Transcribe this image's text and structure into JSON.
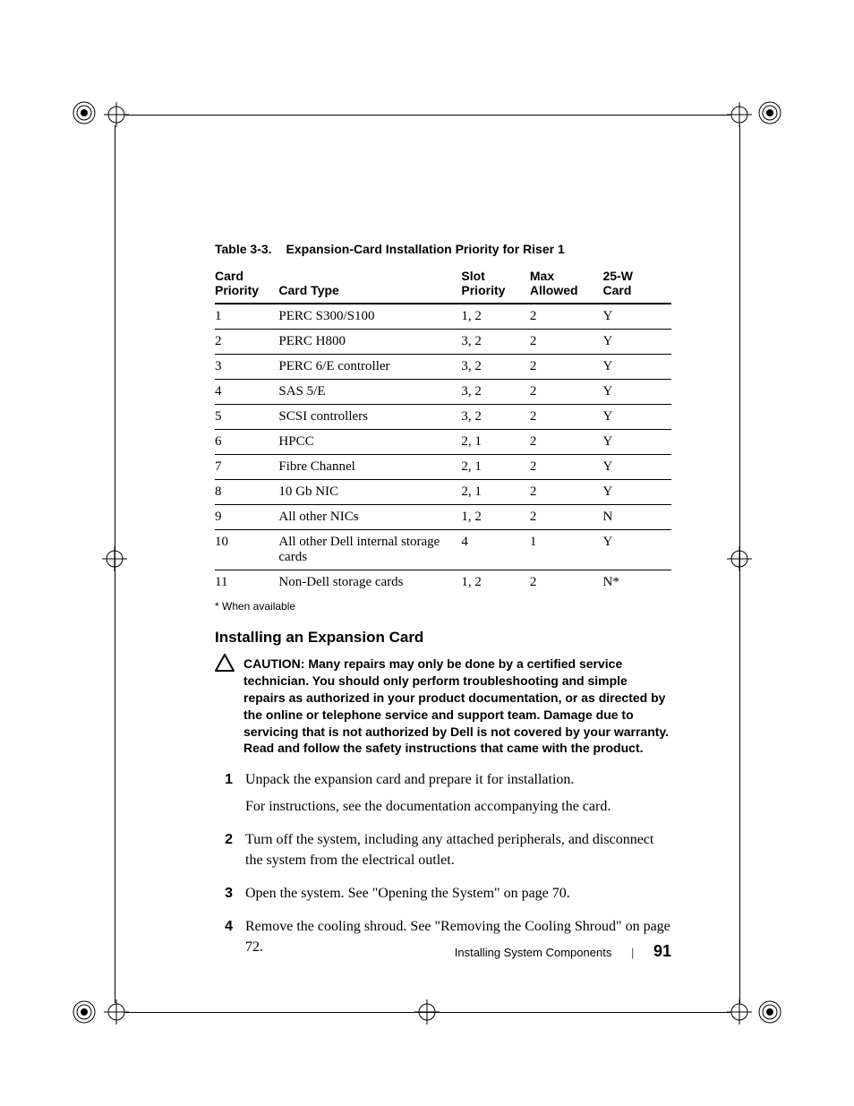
{
  "caption_prefix": "Table 3-3.",
  "caption_title": "Expansion-Card Installation Priority for Riser 1",
  "table": {
    "headers": {
      "priority": "Card\nPriority",
      "type": "Card Type",
      "slot": "Slot\nPriority",
      "max": "Max\nAllowed",
      "w25": "25-W\nCard"
    },
    "rows": [
      {
        "priority": "1",
        "type": "PERC S300/S100",
        "slot": "1, 2",
        "max": "2",
        "w25": "Y"
      },
      {
        "priority": "2",
        "type": "PERC H800",
        "slot": "3, 2",
        "max": "2",
        "w25": "Y"
      },
      {
        "priority": "3",
        "type": "PERC 6/E controller",
        "slot": "3, 2",
        "max": "2",
        "w25": "Y"
      },
      {
        "priority": "4",
        "type": "SAS 5/E",
        "slot": "3, 2",
        "max": "2",
        "w25": "Y"
      },
      {
        "priority": "5",
        "type": "SCSI controllers",
        "slot": "3, 2",
        "max": "2",
        "w25": "Y"
      },
      {
        "priority": "6",
        "type": "HPCC",
        "slot": "2, 1",
        "max": "2",
        "w25": "Y"
      },
      {
        "priority": "7",
        "type": "Fibre Channel",
        "slot": "2, 1",
        "max": "2",
        "w25": "Y"
      },
      {
        "priority": "8",
        "type": "10 Gb NIC",
        "slot": "2, 1",
        "max": "2",
        "w25": "Y"
      },
      {
        "priority": "9",
        "type": "All other NICs",
        "slot": "1, 2",
        "max": "2",
        "w25": "N"
      },
      {
        "priority": "10",
        "type": "All other Dell internal storage cards",
        "slot": "4",
        "max": "1",
        "w25": "Y"
      },
      {
        "priority": "11",
        "type": "Non-Dell storage cards",
        "slot": "1, 2",
        "max": "2",
        "w25": "N*"
      }
    ]
  },
  "footnote": "* When available",
  "section_heading": "Installing an Expansion Card",
  "caution_label": "CAUTION:",
  "caution_text": "Many repairs may only be done by a certified service technician. You should only perform troubleshooting and simple repairs as authorized in your product documentation, or as directed by the online or telephone service and support team. Damage due to servicing that is not authorized by Dell is not covered by your warranty. Read and follow the safety instructions that came with the product.",
  "steps": [
    {
      "n": "1",
      "p1": "Unpack the expansion card and prepare it for installation.",
      "p2": "For instructions, see the documentation accompanying the card."
    },
    {
      "n": "2",
      "p1": "Turn off the system, including any attached peripherals, and disconnect the system from the electrical outlet."
    },
    {
      "n": "3",
      "p1": "Open the system. See \"Opening the System\" on page 70."
    },
    {
      "n": "4",
      "p1": "Remove the cooling shroud. See \"Removing the Cooling Shroud\" on page 72."
    }
  ],
  "footer_section": "Installing System Components",
  "footer_page": "91"
}
